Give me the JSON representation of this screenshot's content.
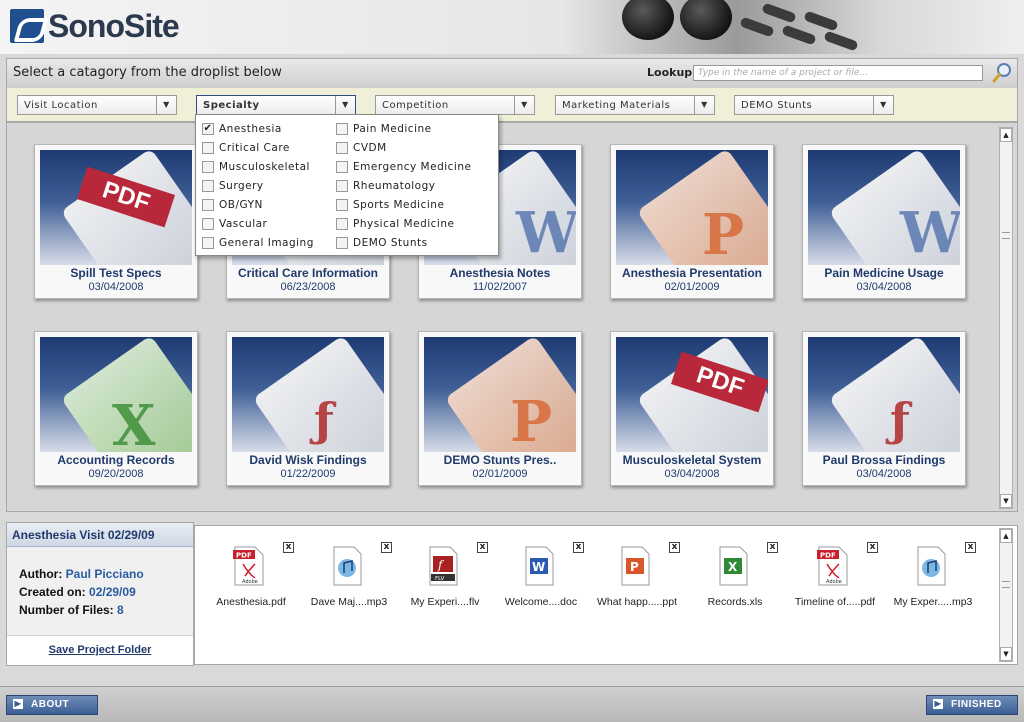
{
  "brand": {
    "logo_text": "SonoSite"
  },
  "topbar": {
    "instruction": "Select a catagory from the droplist below",
    "lookup_label": "Lookup:",
    "lookup_placeholder": "Type in the name of a project or file..."
  },
  "filters": [
    {
      "label": "Visit Location",
      "active": false
    },
    {
      "label": "Specialty",
      "active": true
    },
    {
      "label": "Competition",
      "active": false
    },
    {
      "label": "Marketing Materials",
      "active": false
    },
    {
      "label": "DEMO Stunts",
      "active": false
    }
  ],
  "specialty_menu": {
    "col1": [
      {
        "label": "Anesthesia",
        "checked": true
      },
      {
        "label": "Critical Care",
        "checked": false
      },
      {
        "label": "Musculoskeletal",
        "checked": false
      },
      {
        "label": "Surgery",
        "checked": false
      },
      {
        "label": "OB/GYN",
        "checked": false
      },
      {
        "label": "Vascular",
        "checked": false
      },
      {
        "label": "General Imaging",
        "checked": false
      }
    ],
    "col2": [
      {
        "label": "Pain Medicine",
        "checked": false
      },
      {
        "label": "CVDM",
        "checked": false
      },
      {
        "label": "Emergency Medicine",
        "checked": false
      },
      {
        "label": "Rheumatology",
        "checked": false
      },
      {
        "label": "Sports Medicine",
        "checked": false
      },
      {
        "label": "Physical Medicine",
        "checked": false
      },
      {
        "label": "DEMO Stunts",
        "checked": false
      }
    ]
  },
  "projects": [
    {
      "title": "Spill Test Specs",
      "date": "03/04/2008",
      "icon": "pdf-icon"
    },
    {
      "title": "Critical Care Information",
      "date": "06/23/2008",
      "icon": "word-icon"
    },
    {
      "title": "Anesthesia Notes",
      "date": "11/02/2007",
      "icon": "word-icon"
    },
    {
      "title": "Anesthesia Presentation",
      "date": "02/01/2009",
      "icon": "powerpoint-icon"
    },
    {
      "title": "Pain Medicine Usage",
      "date": "03/04/2008",
      "icon": "word-icon"
    },
    {
      "title": "Accounting Records",
      "date": "09/20/2008",
      "icon": "excel-icon"
    },
    {
      "title": "David Wisk Findings",
      "date": "01/22/2009",
      "icon": "flash-video-icon"
    },
    {
      "title": "DEMO Stunts Pres..",
      "date": "02/01/2009",
      "icon": "powerpoint-icon"
    },
    {
      "title": "Musculoskeletal System",
      "date": "03/04/2008",
      "icon": "pdf-icon"
    },
    {
      "title": "Paul Brossa Findings",
      "date": "03/04/2008",
      "icon": "flash-video-icon"
    }
  ],
  "project_detail": {
    "title": "Anesthesia Visit 02/29/09",
    "author_label": "Author:",
    "author": "Paul Picciano",
    "created_label": "Created on:",
    "created": "02/29/09",
    "files_label": "Number of Files:",
    "files_count": "8",
    "save_label": "Save Project Folder"
  },
  "files": [
    {
      "name": "Anesthesia.pdf",
      "icon": "pdf-file-icon"
    },
    {
      "name": "Dave Maj....mp3",
      "icon": "audio-file-icon"
    },
    {
      "name": "My Experi....flv",
      "icon": "flv-file-icon"
    },
    {
      "name": "Welcome....doc",
      "icon": "word-file-icon"
    },
    {
      "name": "What happ.....ppt",
      "icon": "powerpoint-file-icon"
    },
    {
      "name": "Records.xls",
      "icon": "excel-file-icon"
    },
    {
      "name": "Timeline of.....pdf",
      "icon": "pdf-file-icon"
    },
    {
      "name": "My Exper.....mp3",
      "icon": "audio-file-icon"
    }
  ],
  "footer": {
    "about_label": "ABOUT",
    "finished_label": "FINISHED"
  }
}
